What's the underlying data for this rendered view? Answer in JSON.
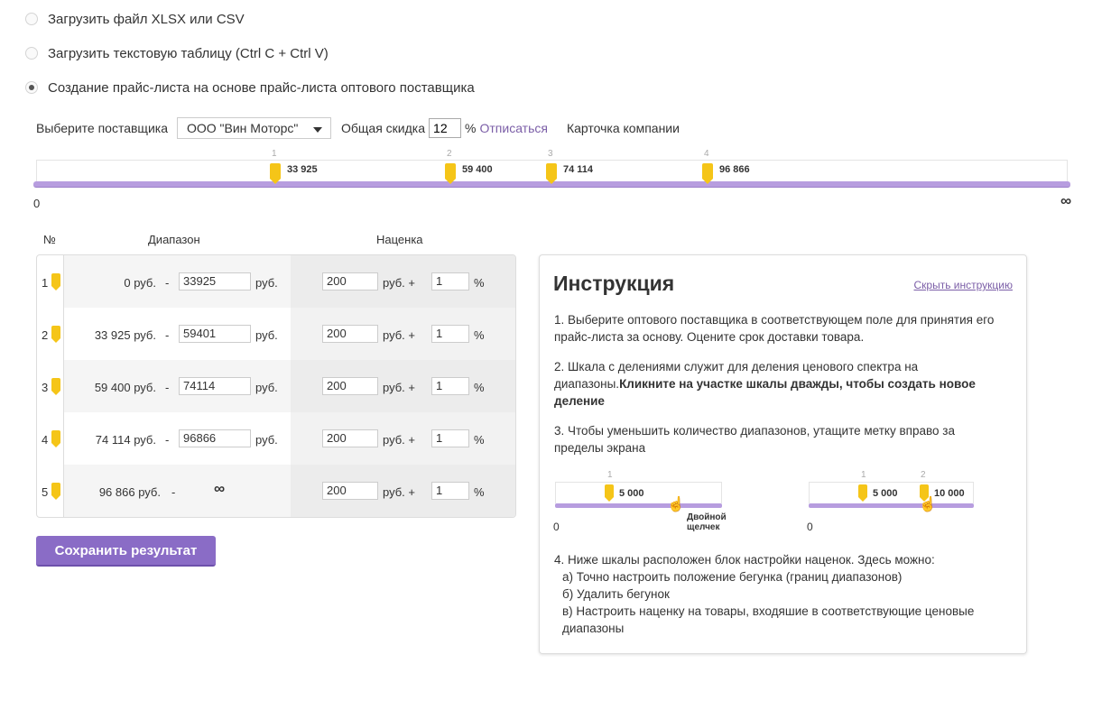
{
  "options": [
    {
      "label": "Загрузить файл XLSX или CSV",
      "checked": false
    },
    {
      "label": "Загрузить текстовую таблицу (Ctrl C + Ctrl V)",
      "checked": false
    },
    {
      "label": "Создание прайс-листа на основе прайс-листа оптового поставщика",
      "checked": true
    }
  ],
  "supplier": {
    "label": "Выберите поставщика",
    "selected": "ООО \"Вин Моторс\"",
    "discount_label": "Общая скидка",
    "discount_value": "12",
    "percent": "%",
    "unsubscribe": "Отписаться",
    "company_card": "Карточка компании"
  },
  "scale": {
    "start_label": "0",
    "end_label": "∞",
    "markers": [
      {
        "num": "1",
        "value": "33 925"
      },
      {
        "num": "2",
        "value": "59 400"
      },
      {
        "num": "3",
        "value": "74 114"
      },
      {
        "num": "4",
        "value": "96 866"
      }
    ]
  },
  "table": {
    "headers": {
      "num": "№",
      "range": "Диапазон",
      "markup": "Наценка"
    },
    "rows": [
      {
        "num": "1",
        "from": "0 руб.",
        "sep": "-",
        "to": "33925",
        "to_unit": "руб.",
        "markup_rub": "200",
        "rub_plus": "руб. +",
        "markup_pct": "1",
        "pct": "%"
      },
      {
        "num": "2",
        "from": "33 925 руб.",
        "sep": "-",
        "to": "59401",
        "to_unit": "руб.",
        "markup_rub": "200",
        "rub_plus": "руб. +",
        "markup_pct": "1",
        "pct": "%"
      },
      {
        "num": "3",
        "from": "59 400 руб.",
        "sep": "-",
        "to": "74114",
        "to_unit": "руб.",
        "markup_rub": "200",
        "rub_plus": "руб. +",
        "markup_pct": "1",
        "pct": "%"
      },
      {
        "num": "4",
        "from": "74 114 руб.",
        "sep": "-",
        "to": "96866",
        "to_unit": "руб.",
        "markup_rub": "200",
        "rub_plus": "руб. +",
        "markup_pct": "1",
        "pct": "%"
      },
      {
        "num": "5",
        "from": "96 866 руб.",
        "sep": "-",
        "to_infinity": "∞",
        "markup_rub": "200",
        "rub_plus": "руб. +",
        "markup_pct": "1",
        "pct": "%"
      }
    ]
  },
  "save_button": "Сохранить результат",
  "instruction": {
    "title": "Инструкция",
    "hide_link": "Скрыть инструкцию",
    "p1": "1. Выберите оптового поставщика в соответствующем поле для принятия его прайс-листа за основу. Оцените срок доставки товара.",
    "p2_plain": "2. Шкала с делениями служит для деления ценового спектра на диапазоны.",
    "p2_bold": "Кликните на участке шкалы дважды, чтобы создать новое деление",
    "p3": "3. Чтобы уменьшить количество диапазонов, утащите метку вправо за пределы экрана",
    "demo1": {
      "num": "1",
      "value": "5 000",
      "zero": "0",
      "caption": "Двойной щелчек"
    },
    "demo2": {
      "num1": "1",
      "num2": "2",
      "value1": "5 000",
      "value2": "10 000",
      "zero": "0"
    },
    "p4_lines": [
      "4. Ниже шкалы расположен блок настройки наценок. Здесь можно:",
      "а) Точно настроить положение бегунка (границ диапазонов)",
      "б) Удалить бегунок",
      "в) Настроить наценку на товары, входяшие в соответствующие ценовые",
      "диапазоны"
    ]
  },
  "colors": {
    "accent": "#8a6cc6",
    "marker": "#f5c518",
    "scale_bar": "#b79ddf",
    "link": "#7b5ea7"
  }
}
